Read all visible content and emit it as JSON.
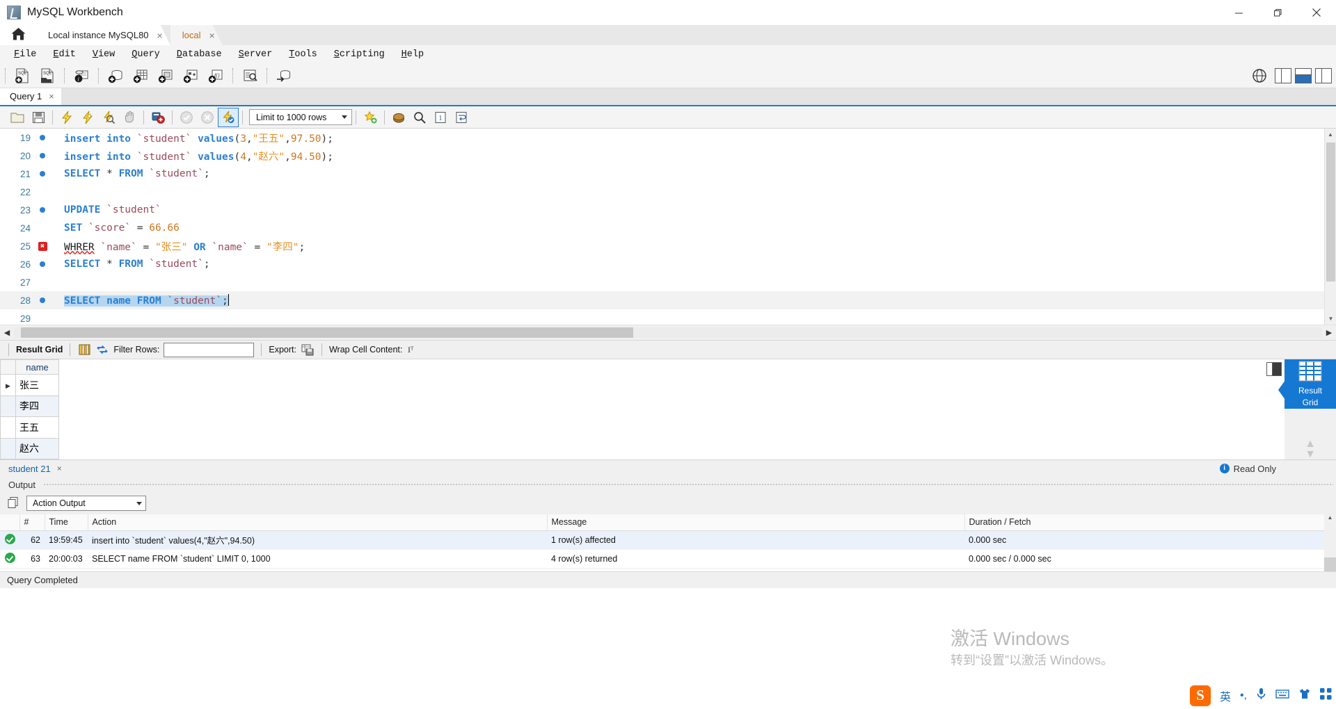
{
  "window": {
    "title": "MySQL Workbench",
    "icon": "workbench-logo-icon",
    "minimize": "minimize-icon",
    "maximize": "restore-icon",
    "close": "close-icon"
  },
  "connection_tabs": {
    "home_icon": "home-icon",
    "tabs": [
      {
        "label": "Local instance MySQL80",
        "close": "×",
        "active": false
      },
      {
        "label": "local",
        "close": "×",
        "active": true
      }
    ]
  },
  "menubar": {
    "items": [
      {
        "label": "File",
        "mnemonic": "F"
      },
      {
        "label": "Edit",
        "mnemonic": "E"
      },
      {
        "label": "View",
        "mnemonic": "V"
      },
      {
        "label": "Query",
        "mnemonic": "Q"
      },
      {
        "label": "Database",
        "mnemonic": "D"
      },
      {
        "label": "Server",
        "mnemonic": "S"
      },
      {
        "label": "Tools",
        "mnemonic": "T"
      },
      {
        "label": "Scripting",
        "mnemonic": "S"
      },
      {
        "label": "Help",
        "mnemonic": "H"
      }
    ]
  },
  "main_toolbar": {
    "buttons": [
      "new-sql-tab-icon",
      "open-sql-script-icon",
      "connection-info-icon",
      "create-schema-icon",
      "create-table-icon",
      "create-view-icon",
      "create-procedure-icon",
      "create-function-icon",
      "search-data-icon",
      "reconnect-server-icon"
    ],
    "right_buttons": [
      "globe-icon",
      "toggle-sidebar-icon",
      "toggle-output-icon",
      "toggle-secondary-sidebar-icon"
    ]
  },
  "query_tab": {
    "label": "Query 1",
    "close": "×"
  },
  "editor_toolbar": {
    "buttons": [
      "open-file-icon",
      "save-file-icon",
      "execute-statement-icon",
      "execute-current-statement-icon",
      "explain-query-icon",
      "stop-execution-icon",
      "toggle-breakpoint-icon",
      "commit-icon",
      "rollback-icon",
      "auto-commit-icon"
    ],
    "limit_value": "Limit to 1000 rows",
    "limit_caret": "chevron-down-icon",
    "after_limit_buttons": [
      "beautify-sql-icon",
      "find-icon",
      "toggle-invisible-chars-icon",
      "wrap-lines-icon",
      "snippets-icon"
    ]
  },
  "editor": {
    "lines": [
      {
        "num": "19",
        "mark": "dot",
        "tokens": [
          {
            "t": "insert into ",
            "c": "kw"
          },
          {
            "t": "`student`",
            "c": "id"
          },
          {
            "t": " ",
            "c": "pun"
          },
          {
            "t": "values",
            "c": "kw"
          },
          {
            "t": "(",
            "c": "pun"
          },
          {
            "t": "3",
            "c": "num"
          },
          {
            "t": ",",
            "c": "pun"
          },
          {
            "t": "\"王五\"",
            "c": "str"
          },
          {
            "t": ",",
            "c": "pun"
          },
          {
            "t": "97.50",
            "c": "num"
          },
          {
            "t": ");",
            "c": "pun"
          }
        ]
      },
      {
        "num": "20",
        "mark": "dot",
        "tokens": [
          {
            "t": "insert into ",
            "c": "kw"
          },
          {
            "t": "`student`",
            "c": "id"
          },
          {
            "t": " ",
            "c": "pun"
          },
          {
            "t": "values",
            "c": "kw"
          },
          {
            "t": "(",
            "c": "pun"
          },
          {
            "t": "4",
            "c": "num"
          },
          {
            "t": ",",
            "c": "pun"
          },
          {
            "t": "\"赵六\"",
            "c": "str"
          },
          {
            "t": ",",
            "c": "pun"
          },
          {
            "t": "94.50",
            "c": "num"
          },
          {
            "t": ");",
            "c": "pun"
          }
        ]
      },
      {
        "num": "21",
        "mark": "dot",
        "tokens": [
          {
            "t": "SELECT ",
            "c": "kw"
          },
          {
            "t": "* ",
            "c": "pun"
          },
          {
            "t": "FROM ",
            "c": "kw"
          },
          {
            "t": "`student`",
            "c": "id"
          },
          {
            "t": ";",
            "c": "pun"
          }
        ]
      },
      {
        "num": "22",
        "mark": "none",
        "tokens": []
      },
      {
        "num": "23",
        "mark": "dot",
        "tokens": [
          {
            "t": "UPDATE ",
            "c": "kw"
          },
          {
            "t": "`student`",
            "c": "id"
          }
        ]
      },
      {
        "num": "24",
        "mark": "none",
        "tokens": [
          {
            "t": "SET ",
            "c": "kw"
          },
          {
            "t": "`score`",
            "c": "id"
          },
          {
            "t": " = ",
            "c": "pun"
          },
          {
            "t": "66.66",
            "c": "num"
          }
        ]
      },
      {
        "num": "25",
        "mark": "error",
        "tokens": [
          {
            "t": "WHRER",
            "c": "err-word"
          },
          {
            "t": " ",
            "c": "pun"
          },
          {
            "t": "`name`",
            "c": "id"
          },
          {
            "t": " = ",
            "c": "pun"
          },
          {
            "t": "\"张三\"",
            "c": "str"
          },
          {
            "t": " ",
            "c": "pun"
          },
          {
            "t": "OR",
            "c": "kw"
          },
          {
            "t": " ",
            "c": "pun"
          },
          {
            "t": "`name`",
            "c": "id"
          },
          {
            "t": " = ",
            "c": "pun"
          },
          {
            "t": "\"李四\"",
            "c": "str"
          },
          {
            "t": ";",
            "c": "pun"
          }
        ]
      },
      {
        "num": "26",
        "mark": "dot",
        "tokens": [
          {
            "t": "SELECT ",
            "c": "kw"
          },
          {
            "t": "* ",
            "c": "pun"
          },
          {
            "t": "FROM ",
            "c": "kw"
          },
          {
            "t": "`student`",
            "c": "id"
          },
          {
            "t": ";",
            "c": "pun"
          }
        ]
      },
      {
        "num": "27",
        "mark": "none",
        "tokens": []
      },
      {
        "num": "28",
        "mark": "dot",
        "selected": true,
        "caret": true,
        "tokens": [
          {
            "t": "SELECT name FROM ",
            "c": "kw"
          },
          {
            "t": "`student`",
            "c": "id"
          },
          {
            "t": ";",
            "c": "pun"
          }
        ]
      },
      {
        "num": "29",
        "mark": "none",
        "tokens": []
      }
    ]
  },
  "result_toolbar": {
    "label": "Result Grid",
    "grid_view_icon": "grid-view-icon",
    "refresh_icon": "refresh-icon",
    "filter_label": "Filter Rows:",
    "filter_value": "",
    "filter_placeholder": "",
    "export_label": "Export:",
    "export_icon": "export-recordset-icon",
    "wrap_label": "Wrap Cell Content:",
    "wrap_icon": "wrap-cell-icon"
  },
  "result_grid": {
    "columns": [
      "name"
    ],
    "rows": [
      {
        "selected": true,
        "values": [
          "张三"
        ]
      },
      {
        "selected": false,
        "values": [
          "李四"
        ]
      },
      {
        "selected": false,
        "values": [
          "王五"
        ]
      },
      {
        "selected": false,
        "values": [
          "赵六"
        ]
      }
    ],
    "side_tile": {
      "line1": "Result",
      "line2": "Grid",
      "icon": "result-grid-icon"
    },
    "side_arrows": {
      "up": "chevron-up-icon",
      "down": "chevron-down-icon"
    }
  },
  "result_footer": {
    "tab_label": "student 21",
    "tab_close": "×",
    "readonly_label": "Read Only",
    "readonly_badge": "i"
  },
  "output": {
    "title": "Output",
    "copy_icon": "copy-icon",
    "selector_value": "Action Output",
    "selector_caret": "chevron-down-icon",
    "columns": [
      "#",
      "Time",
      "Action",
      "Message",
      "Duration / Fetch"
    ],
    "rows": [
      {
        "status": "success",
        "n": "62",
        "time": "19:59:45",
        "action": "insert into `student` values(4,\"赵六\",94.50)",
        "message": "1 row(s) affected",
        "duration": "0.000 sec"
      },
      {
        "status": "success",
        "n": "63",
        "time": "20:00:03",
        "action": "SELECT name FROM `student` LIMIT 0, 1000",
        "message": "4 row(s) returned",
        "duration": "0.000 sec / 0.000 sec"
      }
    ]
  },
  "statusbar": {
    "text": "Query Completed"
  },
  "watermark": {
    "line1": "激活 Windows",
    "line2": "转到“设置”以激活 Windows。"
  },
  "ime_tray": {
    "logo": "S",
    "items": [
      "英",
      "•,",
      "mic-icon",
      "keyboard-icon",
      "skin-icon",
      "apps-icon"
    ]
  },
  "colors": {
    "accent": "#1578d3",
    "tab_active_text": "#c46a10",
    "keyword": "#2a7fd4",
    "identifier": "#9b4a5a",
    "string": "#e89020",
    "number": "#d2761e",
    "error": "#e02020",
    "success": "#2aa84a",
    "selection": "#b5d6f0"
  }
}
